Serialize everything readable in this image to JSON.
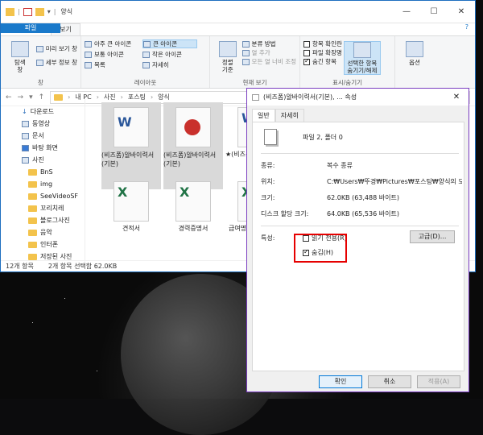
{
  "explorer": {
    "title": "양식",
    "winbtns": [
      "—",
      "☐",
      "✕"
    ],
    "tabs": [
      "파일",
      "홈",
      "공유",
      "보기"
    ],
    "ribbon": {
      "pane_group": {
        "label": "창",
        "nav_pane": "탐색\n창",
        "preview_pane": "미리 보기 창",
        "details_pane": "세부 정보 창"
      },
      "layout_group": {
        "label": "레이아웃",
        "items": [
          "아주 큰 아이콘",
          "큰 아이콘",
          "보통 아이콘",
          "작은 아이콘",
          "목록",
          "자세히"
        ]
      },
      "view_group": {
        "label": "현재 보기",
        "sort": "정렬\n기준",
        "group_by": "분류 방법",
        "add_columns": "열 추가",
        "fit_columns": "모든 열 너비 조정"
      },
      "showhide_group": {
        "label": "표시/숨기기",
        "item_checkboxes": "항목 확인란",
        "file_ext": "파일 확장명",
        "hidden_items": "숨긴 항목",
        "hide_selected": "선택한 항목\n숨기기/해제"
      },
      "options": "옵션"
    },
    "address": [
      "내 PC",
      "사진",
      "포스팅",
      "양식"
    ],
    "nav": [
      "다운로드",
      "동영상",
      "문서",
      "바탕 화면",
      "사진",
      "BnS",
      "img",
      "SeeVideoSF",
      "꼬리치레",
      "블로그사진",
      "음악",
      "인터폰",
      "저장된 사진"
    ],
    "files": [
      {
        "name": "(비즈폼)알바이력서(기본)",
        "type": "word"
      },
      {
        "name": "(비즈폼)알바이력서(기본)",
        "type": "pdf"
      },
      {
        "name": "★(비즈폼)알바이력서",
        "type": "word"
      },
      {
        "name": "견적서",
        "type": "excel"
      },
      {
        "name": "경력증명서",
        "type": "excel"
      },
      {
        "name": "급여명",
        "type": "excel"
      }
    ],
    "status": {
      "count": "12개 항목",
      "selected": "2개 항목 선택함 62.0KB"
    }
  },
  "dialog": {
    "title": "(비즈폼)알바이력서(기본), ... 속성",
    "tabs": [
      "일반",
      "자세히"
    ],
    "summary": "파일 2, 폴더 0",
    "rows": [
      {
        "label": "종류:",
        "value": "복수 종류"
      },
      {
        "label": "위치:",
        "value": "C:₩Users₩뚜경₩Pictures₩포스팅₩양식의 모든 I"
      },
      {
        "label": "크기:",
        "value": "62.0KB (63,488 바이트)"
      },
      {
        "label": "디스크 할당 크기:",
        "value": "64.0KB (65,536 바이트)"
      }
    ],
    "attr_label": "특성:",
    "readonly": "읽기 전용(R)",
    "hidden": "숨김(H)",
    "advanced": "고급(D)...",
    "ok": "확인",
    "cancel": "취소",
    "apply": "적용(A)"
  }
}
